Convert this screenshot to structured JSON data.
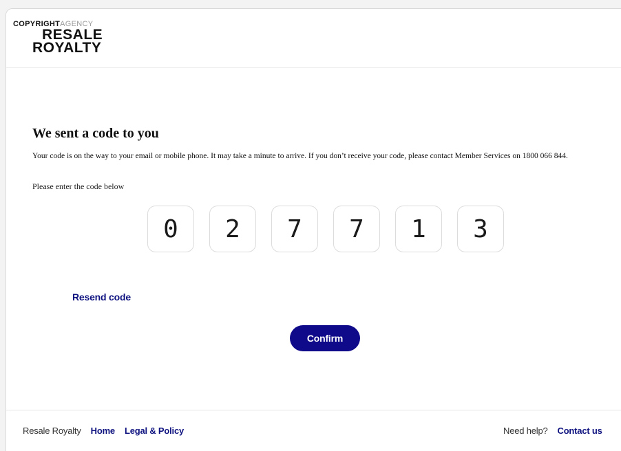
{
  "logo": {
    "top_part1": "COPYRIGHT",
    "top_part2": "AGENCY",
    "line1": "RESALE",
    "line2": "ROYALTY"
  },
  "main": {
    "title": "We sent a code to you",
    "description": "Your code is on the way to your email or mobile phone. It may take a minute to arrive. If you don’t receive your code, please contact Member Services on 1800 066 844.",
    "prompt": "Please enter the code below",
    "code_digits": [
      "0",
      "2",
      "7",
      "7",
      "1",
      "3"
    ],
    "resend_label": "Resend code",
    "confirm_label": "Confirm"
  },
  "footer": {
    "brand": "Resale Royalty",
    "home_label": "Home",
    "legal_label": "Legal & Policy",
    "help_text": "Need help?",
    "contact_label": "Contact us"
  },
  "colors": {
    "accent": "#0f0a8a",
    "link": "#0f1380"
  }
}
